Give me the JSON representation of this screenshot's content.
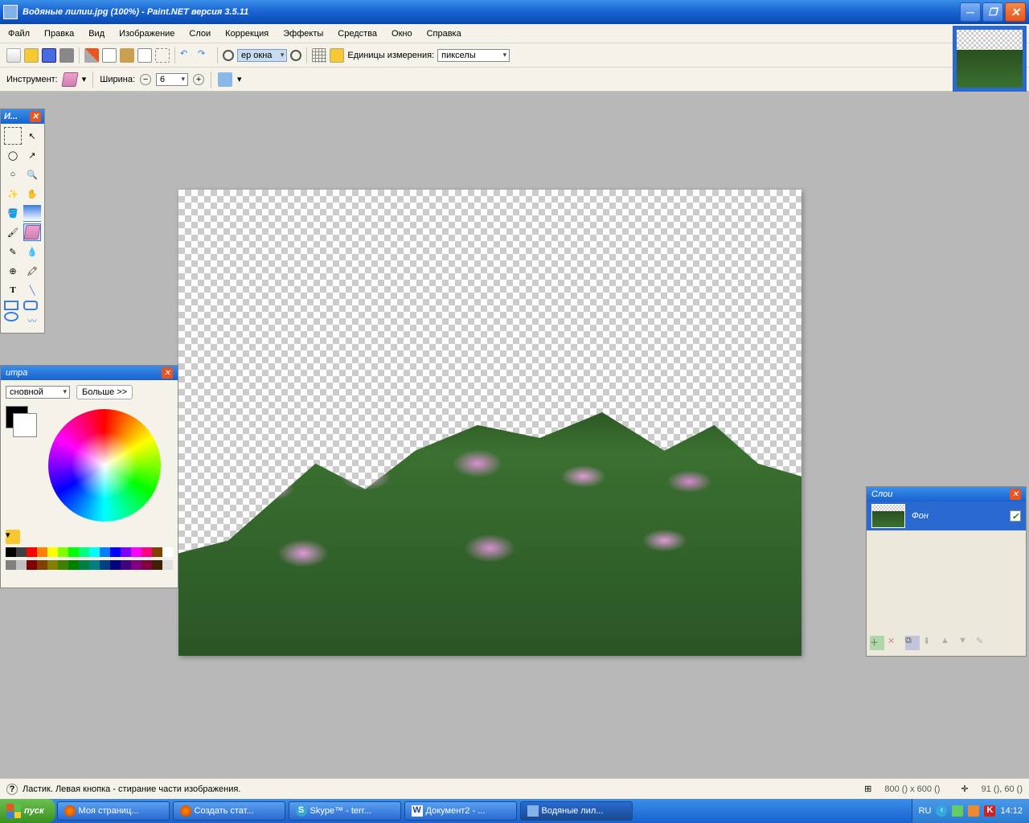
{
  "titlebar": {
    "title": "Водяные лилии.jpg (100%) - Paint.NET версия 3.5.11"
  },
  "menu": {
    "file": "Файл",
    "edit": "Правка",
    "view": "Вид",
    "image": "Изображение",
    "layers": "Слои",
    "adjust": "Коррекция",
    "effects": "Эффекты",
    "tools": "Средства",
    "window": "Окно",
    "help": "Справка"
  },
  "toolbar1": {
    "zoom_select": "ер окна",
    "units_label": "Единицы измерения:",
    "units_value": "пикселы"
  },
  "toolbar2": {
    "tool_label": "Инструмент:",
    "width_label": "Ширина:",
    "width_value": "6"
  },
  "tools_panel": {
    "title": "И..."
  },
  "colors_panel": {
    "title": "итра",
    "mode": "сновной",
    "more": "Больше >>"
  },
  "layers_panel": {
    "title": "Слои",
    "layer0": "Фон"
  },
  "status": {
    "hint": "Ластик. Левая кнопка - стирание части изображения.",
    "size": "800 () x 600 ()",
    "pos": "91 (), 60 ()"
  },
  "taskbar": {
    "start": "пуск",
    "task1": "Моя страниц...",
    "task2": "Создать стат...",
    "task3": "Skype™ - terr...",
    "task4": "Документ2 - ...",
    "task5": "Водяные лил...",
    "lang": "RU",
    "clock": "14:12"
  },
  "palette_colors": [
    "#000000",
    "#404040",
    "#ff0000",
    "#ff8000",
    "#ffff00",
    "#80ff00",
    "#00ff00",
    "#00ff80",
    "#00ffff",
    "#0080ff",
    "#0000ff",
    "#8000ff",
    "#ff00ff",
    "#ff0080",
    "#804000",
    "#ffffff",
    "#808080",
    "#c0c0c0",
    "#800000",
    "#804000",
    "#808000",
    "#408000",
    "#008000",
    "#008040",
    "#008080",
    "#004080",
    "#000080",
    "#400080",
    "#800080",
    "#800040",
    "#402000",
    "#e0e0e0"
  ]
}
